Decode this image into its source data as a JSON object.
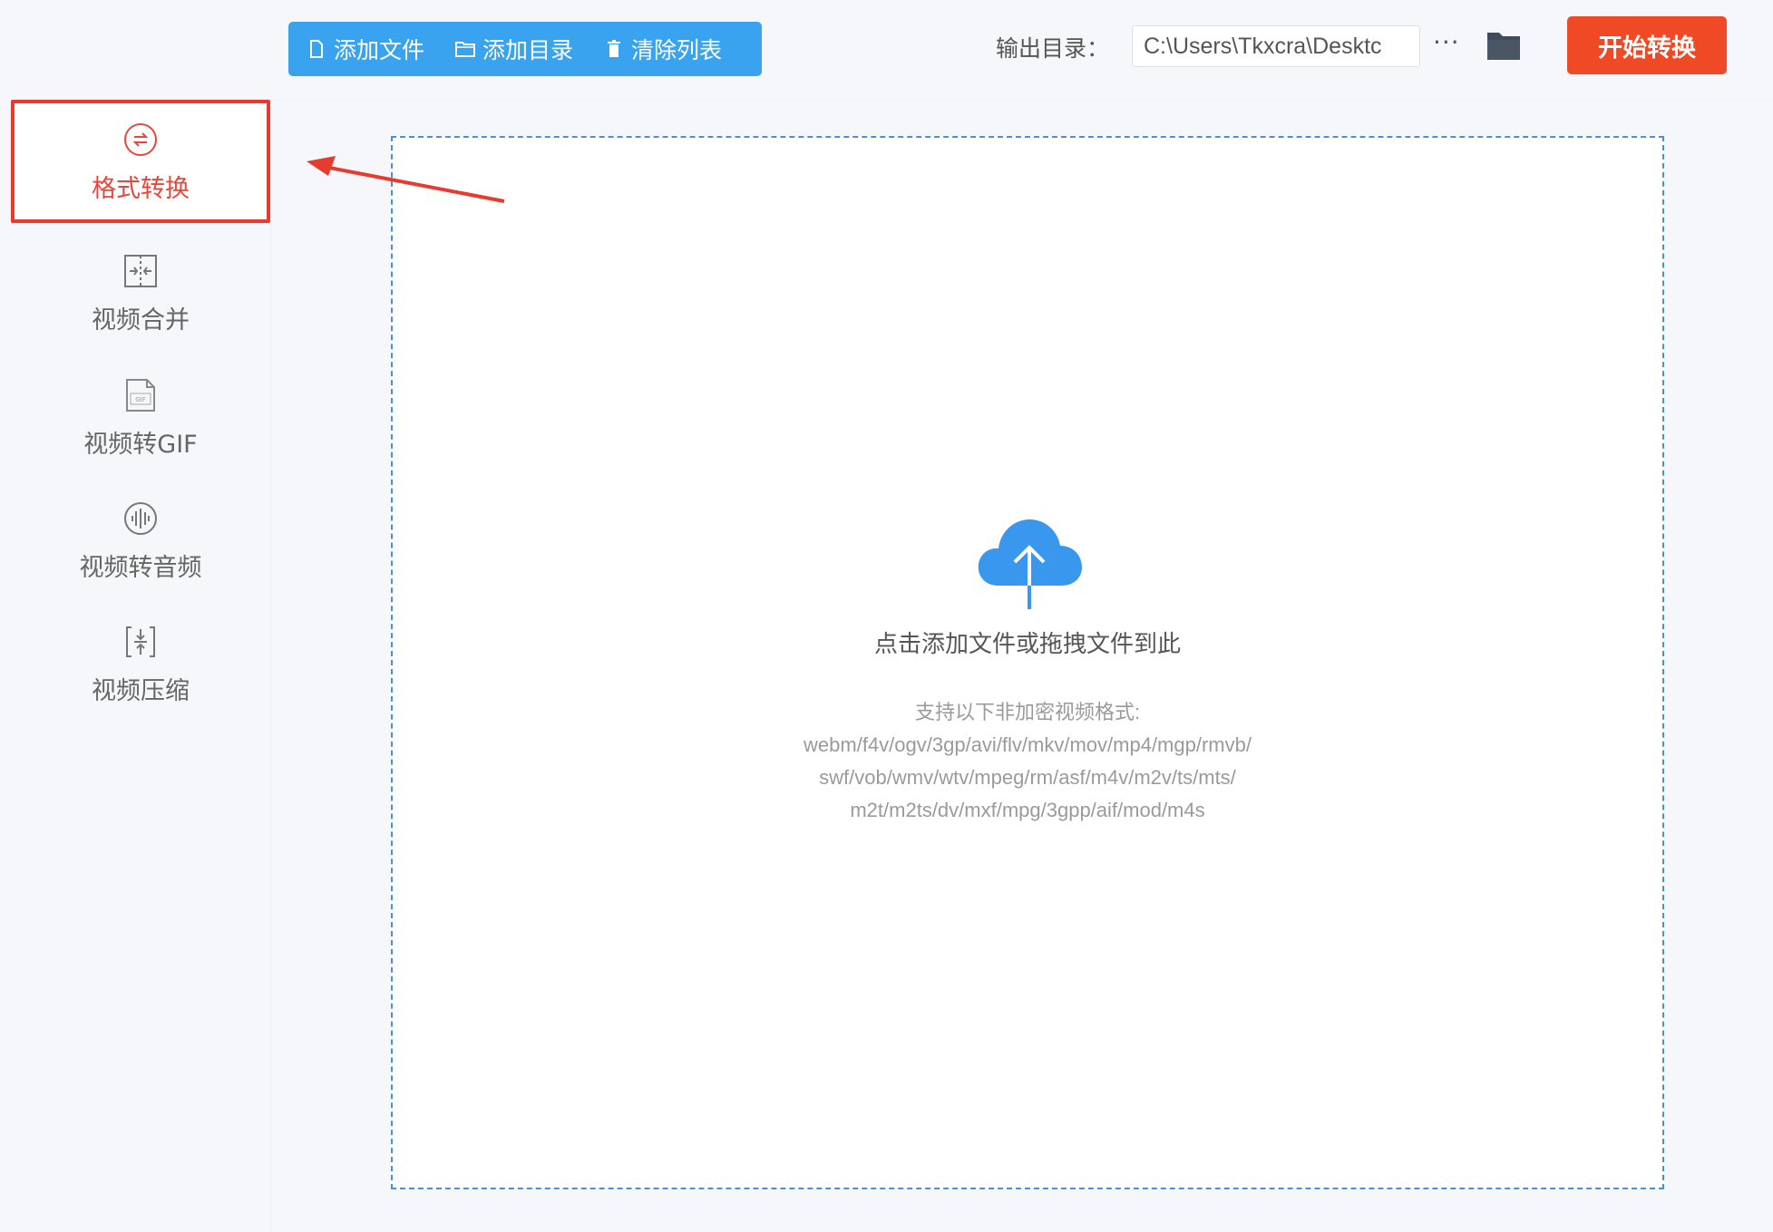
{
  "sidebar": {
    "items": [
      {
        "label": "格式转换",
        "icon": "format-convert-icon",
        "active": true
      },
      {
        "label": "视频合并",
        "icon": "video-merge-icon",
        "active": false
      },
      {
        "label": "视频转GIF",
        "icon": "gif-file-icon",
        "active": false
      },
      {
        "label": "视频转音频",
        "icon": "audio-wave-icon",
        "active": false
      },
      {
        "label": "视频压缩",
        "icon": "compress-icon",
        "active": false
      }
    ]
  },
  "toolbar": {
    "add_file": "添加文件",
    "add_dir": "添加目录",
    "clear_list": "清除列表",
    "output_label": "输出目录：",
    "output_path": "C:\\Users\\Tkxcra\\Desktc",
    "more": "···",
    "start": "开始转换"
  },
  "dropzone": {
    "title": "点击添加文件或拖拽文件到此",
    "support_title": "支持以下非加密视频格式:",
    "formats_line1": "webm/f4v/ogv/3gp/avi/flv/mkv/mov/mp4/mgp/rmvb/",
    "formats_line2": "swf/vob/wmv/wtv/mpeg/rm/asf/m4v/m2v/ts/mts/",
    "formats_line3": "m2t/m2ts/dv/mxf/mpg/3gpp/aif/mod/m4s"
  },
  "colors": {
    "accent_blue": "#3aa3ef",
    "start_red": "#ef4a25",
    "highlight_red": "#e63b2e"
  }
}
